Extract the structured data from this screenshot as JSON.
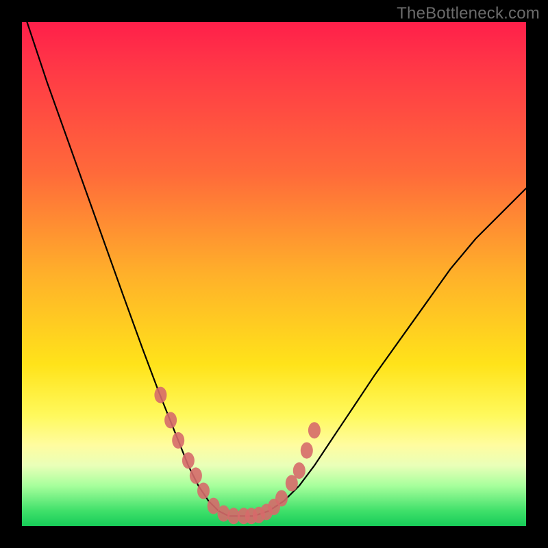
{
  "watermark": "TheBottleneck.com",
  "chart_data": {
    "type": "line",
    "title": "",
    "xlabel": "",
    "ylabel": "",
    "xlim": [
      0,
      100
    ],
    "ylim": [
      0,
      100
    ],
    "legend": false,
    "grid": false,
    "series": [
      {
        "name": "curve",
        "style": "line",
        "color": "#000000",
        "x": [
          1,
          5,
          10,
          15,
          20,
          24,
          27,
          29,
          31,
          33,
          35,
          37,
          39,
          41,
          43,
          46,
          49,
          52,
          55,
          58,
          62,
          66,
          70,
          75,
          80,
          85,
          90,
          95,
          100
        ],
        "y": [
          100,
          88,
          74,
          60,
          46,
          35,
          27,
          22,
          17,
          12,
          8,
          5,
          3,
          2,
          2,
          2,
          3,
          5,
          8,
          12,
          18,
          24,
          30,
          37,
          44,
          51,
          57,
          62,
          67
        ]
      },
      {
        "name": "warm-band-markers",
        "style": "scatter",
        "color": "#d66a6a",
        "x": [
          27.5,
          29.5,
          31,
          33,
          34.5,
          36,
          38,
          40,
          42,
          44,
          45.5,
          47,
          48.5,
          50,
          51.5,
          53.5,
          55,
          56.5,
          58
        ],
        "y": [
          26,
          21,
          17,
          13,
          10,
          7,
          4,
          2.5,
          2,
          2,
          2,
          2.2,
          2.8,
          3.8,
          5.5,
          8.5,
          11,
          15,
          19
        ]
      }
    ],
    "background_gradient": {
      "direction": "top-to-bottom",
      "stops": [
        {
          "pos": 0,
          "color": "#ff1f4a"
        },
        {
          "pos": 30,
          "color": "#ff6a3a"
        },
        {
          "pos": 50,
          "color": "#ffb02a"
        },
        {
          "pos": 70,
          "color": "#ffe31a"
        },
        {
          "pos": 86,
          "color": "#fffca0"
        },
        {
          "pos": 94,
          "color": "#a7ff9c"
        },
        {
          "pos": 100,
          "color": "#17cc58"
        }
      ]
    }
  }
}
